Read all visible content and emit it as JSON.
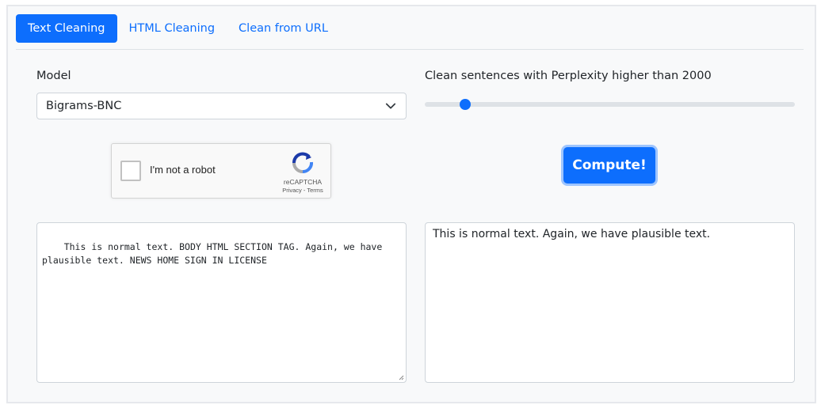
{
  "tabs": [
    {
      "label": "Text Cleaning",
      "active": true
    },
    {
      "label": "HTML Cleaning",
      "active": false
    },
    {
      "label": "Clean from URL",
      "active": false
    }
  ],
  "model": {
    "label": "Model",
    "selected": "Bigrams-BNC"
  },
  "perplexity": {
    "label": "Clean sentences with Perplexity higher than 2000",
    "slider_fraction": 0.11
  },
  "captcha": {
    "label": "I'm not a robot",
    "brand": "reCAPTCHA",
    "links": "Privacy - Terms"
  },
  "compute_label": "Compute!",
  "input_text": "This is normal text. BODY HTML SECTION TAG. Again, we have plausible text. NEWS HOME SIGN IN LICENSE",
  "output_text": "This is normal text. Again, we have plausible text.",
  "colors": {
    "accent": "#0d6efd"
  }
}
